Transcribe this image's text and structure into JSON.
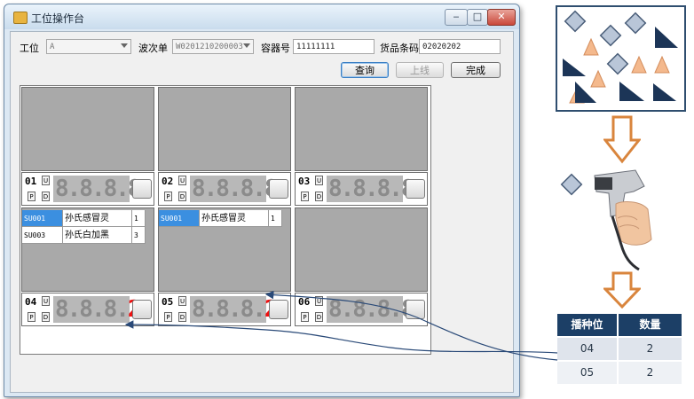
{
  "window": {
    "title": "工位操作台",
    "controls": {
      "minimize": "‒",
      "maximize": "□",
      "close": "✕"
    }
  },
  "form": {
    "station_label": "工位",
    "station_value": "A",
    "wave_label": "波次单",
    "wave_value": "W0201210200003",
    "container_label": "容器号",
    "container_value": "11111111",
    "barcode_label": "货品条码",
    "barcode_value": "02020202"
  },
  "buttons": {
    "query": "查询",
    "online": "上线",
    "finish": "完成"
  },
  "cells": [
    {
      "pos": "01",
      "u": "U",
      "p": "P",
      "d": "D",
      "display": "8.8.8.8.",
      "lit": ""
    },
    {
      "pos": "02",
      "u": "U",
      "p": "P",
      "d": "D",
      "display": "8.8.8.8.",
      "lit": ""
    },
    {
      "pos": "03",
      "u": "U",
      "p": "P",
      "d": "D",
      "display": "8.8.8.8.",
      "lit": ""
    },
    {
      "pos": "04",
      "u": "U",
      "p": "P",
      "d": "D",
      "display": "8.8.8.",
      "lit": "2"
    },
    {
      "pos": "05",
      "u": "U",
      "p": "P",
      "d": "D",
      "display": "8.8.8.",
      "lit": "2"
    },
    {
      "pos": "06",
      "u": "U",
      "p": "P",
      "d": "D",
      "display": "8.8.8.8.",
      "lit": ""
    }
  ],
  "list04": [
    {
      "code": "SU001",
      "name": "孙氏感冒灵",
      "qty": "1"
    },
    {
      "code": "SU003",
      "name": "孙氏白加黑",
      "qty": "3"
    }
  ],
  "list05": [
    {
      "code": "SU001",
      "name": "孙氏感冒灵",
      "qty": "1"
    }
  ],
  "result_table": {
    "headers": [
      "播种位",
      "数量"
    ],
    "rows": [
      [
        "04",
        "2"
      ],
      [
        "05",
        "2"
      ]
    ]
  },
  "colors": {
    "accent": "#1c3f66",
    "selection": "#3b8fe0",
    "led_on": "#ee1111",
    "led_off": "#8b8b8b"
  },
  "icons": {
    "app": "app-icon",
    "scanner": "barcode-scanner-icon"
  }
}
